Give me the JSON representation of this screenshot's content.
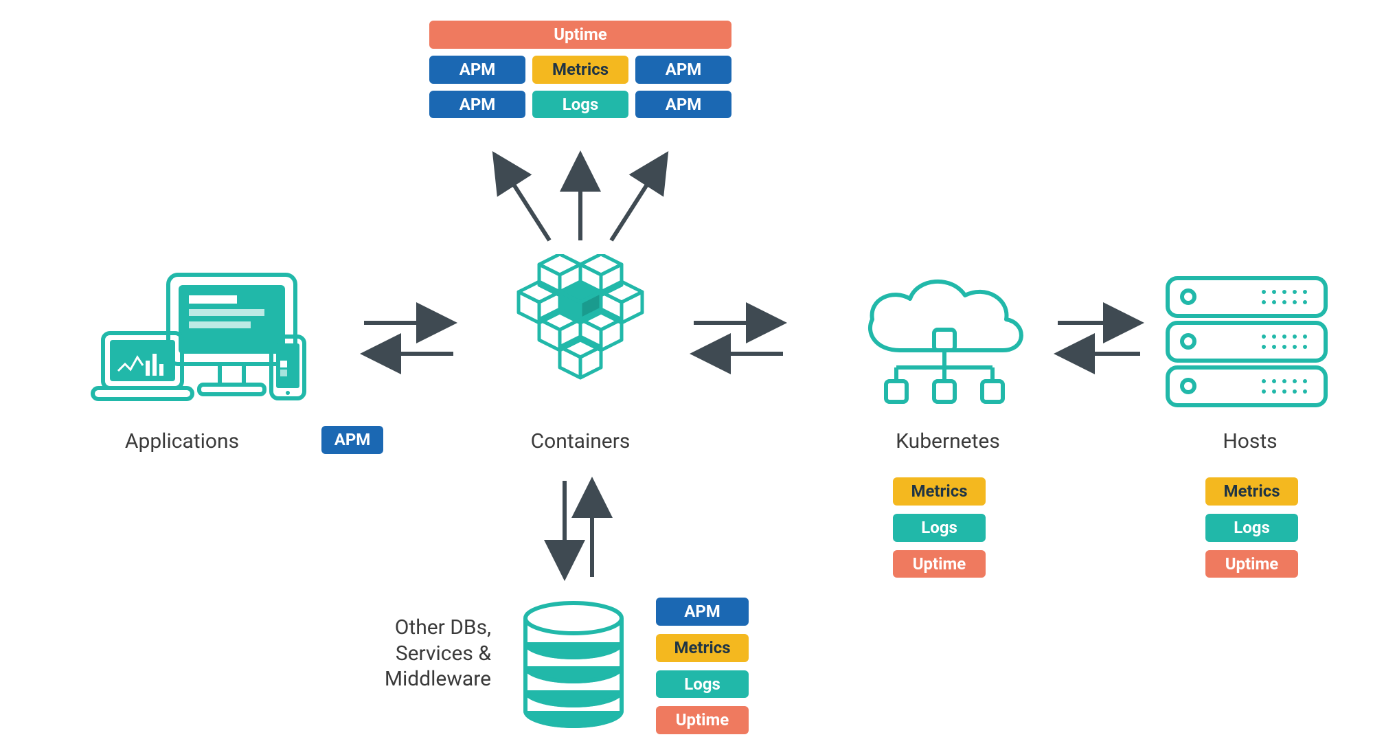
{
  "colors": {
    "teal": "#21b8a9",
    "blue": "#1b68b3",
    "yellow": "#f4b81f",
    "coral": "#ef7a5f",
    "text": "#3a3a3a",
    "arrow": "#3f4a52"
  },
  "nodes": {
    "applications": {
      "label": "Applications",
      "badges": [
        {
          "text": "APM",
          "color": "blue"
        }
      ]
    },
    "containers": {
      "label": "Containers",
      "top_badges": {
        "wide": {
          "text": "Uptime",
          "color": "coral"
        },
        "grid": [
          [
            {
              "text": "APM",
              "color": "blue"
            },
            {
              "text": "Metrics",
              "color": "yellow"
            },
            {
              "text": "APM",
              "color": "blue"
            }
          ],
          [
            {
              "text": "APM",
              "color": "blue"
            },
            {
              "text": "Logs",
              "color": "teal"
            },
            {
              "text": "APM",
              "color": "blue"
            }
          ]
        ]
      }
    },
    "kubernetes": {
      "label": "Kubernetes",
      "badges": [
        {
          "text": "Metrics",
          "color": "yellow"
        },
        {
          "text": "Logs",
          "color": "teal"
        },
        {
          "text": "Uptime",
          "color": "coral"
        }
      ]
    },
    "hosts": {
      "label": "Hosts",
      "badges": [
        {
          "text": "Metrics",
          "color": "yellow"
        },
        {
          "text": "Logs",
          "color": "teal"
        },
        {
          "text": "Uptime",
          "color": "coral"
        }
      ]
    },
    "middleware": {
      "label_lines": [
        "Other DBs,",
        "Services &",
        "Middleware"
      ],
      "badges": [
        {
          "text": "APM",
          "color": "blue"
        },
        {
          "text": "Metrics",
          "color": "yellow"
        },
        {
          "text": "Logs",
          "color": "teal"
        },
        {
          "text": "Uptime",
          "color": "coral"
        }
      ]
    }
  }
}
